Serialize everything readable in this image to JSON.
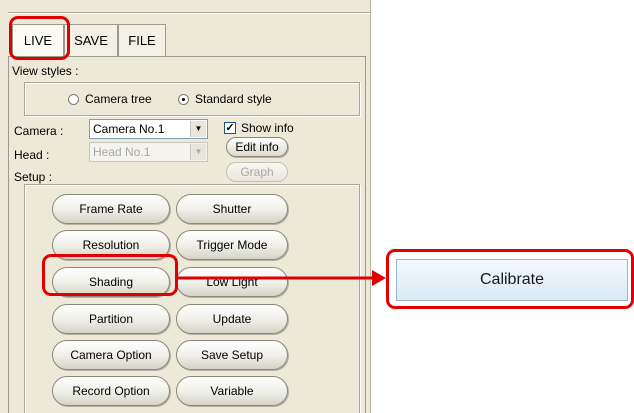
{
  "tabs": [
    {
      "label": "LIVE"
    },
    {
      "label": "SAVE"
    },
    {
      "label": "FILE"
    }
  ],
  "view_styles": {
    "label": "View styles :",
    "options": [
      {
        "label": "Camera tree",
        "selected": false
      },
      {
        "label": "Standard style",
        "selected": true
      }
    ]
  },
  "camera": {
    "label": "Camera :",
    "value": "Camera No.1",
    "show_info_label": "Show info",
    "show_info_checked": true,
    "edit_info_label": "Edit info"
  },
  "head": {
    "label": "Head :",
    "value": "Head No.1",
    "graph_label": "Graph"
  },
  "setup": {
    "label": "Setup :",
    "buttons": [
      "Frame Rate",
      "Shutter",
      "Resolution",
      "Trigger Mode",
      "Shading",
      "Low Light",
      "Partition",
      "Update",
      "Camera Option",
      "Save Setup",
      "Record Option",
      "Variable"
    ]
  },
  "callout": {
    "label": "Calibrate"
  },
  "colors": {
    "highlight": "#e00000",
    "panel": "#ece9d8"
  }
}
